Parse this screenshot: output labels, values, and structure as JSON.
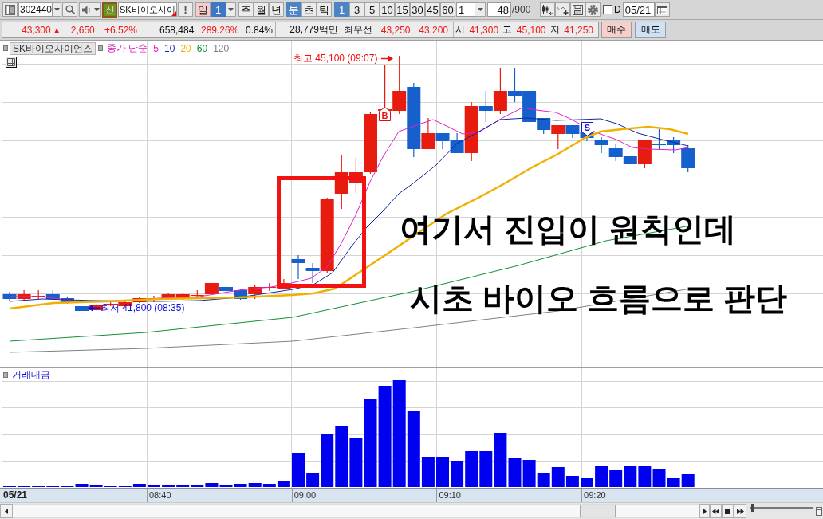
{
  "toolbar": {
    "code_field": {
      "value": "302440"
    },
    "type_badge": "신",
    "name_field": {
      "value": "SK바이오사이"
    },
    "alert_button": "!",
    "day_button": "일",
    "day_count_field": {
      "value": "1"
    },
    "period_buttons": [
      {
        "label": "주",
        "selected": false
      },
      {
        "label": "월",
        "selected": false
      },
      {
        "label": "년",
        "selected": false
      }
    ],
    "unit_buttons": [
      {
        "label": "분",
        "selected": true
      },
      {
        "label": "초",
        "selected": false
      },
      {
        "label": "틱",
        "selected": false
      }
    ],
    "interval_buttons": [
      {
        "label": "1",
        "selected": true
      },
      {
        "label": "3",
        "selected": false
      },
      {
        "label": "5",
        "selected": false
      },
      {
        "label": "10",
        "selected": false
      },
      {
        "label": "15",
        "selected": false
      },
      {
        "label": "30",
        "selected": false
      },
      {
        "label": "45",
        "selected": false
      },
      {
        "label": "60",
        "selected": false
      }
    ],
    "interval_field": {
      "value": "1"
    },
    "count_field": {
      "value": "48"
    },
    "count_total": "/900",
    "checkbox": {
      "label": "D",
      "checked": false
    },
    "date_field": {
      "value": "05/21"
    }
  },
  "quote_bar": {
    "groups": [
      {
        "items": [
          {
            "kind": "up",
            "text": "43,300",
            "sign": "▲"
          },
          {
            "kind": "up",
            "text": "2,650"
          },
          {
            "kind": "up",
            "text": "+6.52%"
          }
        ]
      },
      {
        "items": [
          {
            "kind": "flat",
            "text": "658,484"
          },
          {
            "kind": "up",
            "text": "289.26%"
          },
          {
            "kind": "flat",
            "text": "0.84%"
          }
        ]
      },
      {
        "items": [
          {
            "kind": "flat",
            "text": "28,779백만"
          }
        ]
      },
      {
        "items": [
          {
            "kind": "label",
            "text": "최우선"
          },
          {
            "kind": "up",
            "text": "43,250"
          },
          {
            "kind": "up",
            "text": "43,200"
          }
        ]
      },
      {
        "items": [
          {
            "kind": "label",
            "text": "시"
          },
          {
            "kind": "up",
            "text": "41,300"
          },
          {
            "kind": "label",
            "text": "고"
          },
          {
            "kind": "up",
            "text": "45,100"
          },
          {
            "kind": "label",
            "text": "저"
          },
          {
            "kind": "up",
            "text": "41,250"
          }
        ]
      }
    ],
    "buy_button": "매수",
    "sell_button": "매도"
  },
  "chart": {
    "series_name": "SK바이오사이언스",
    "ma_type": "종가 단순",
    "ma_legend": [
      {
        "label": "5",
        "color": "#e020c8"
      },
      {
        "label": "10",
        "color": "#1428a0"
      },
      {
        "label": "20",
        "color": "#f0b000"
      },
      {
        "label": "60",
        "color": "#109030"
      },
      {
        "label": "120",
        "color": "#808080"
      }
    ],
    "extremes": [
      {
        "kind": "high",
        "text": "최고 45,100 (09:07)"
      },
      {
        "kind": "low",
        "text": "최저 41,800 (08:35)"
      }
    ],
    "signals": [
      {
        "kind": "buy",
        "label": "B"
      },
      {
        "kind": "sell",
        "label": "S"
      }
    ],
    "annotations": [
      "여기서 진입이 원칙인데",
      "시초 바이오 흐름으로 판단"
    ]
  },
  "volume_panel": {
    "title": "거래대금"
  },
  "x_axis": {
    "date": "05/21",
    "ticks": [
      "08:40",
      "09:00",
      "09:10",
      "09:20"
    ]
  },
  "scroll_bar": {
    "zoom_slider": {
      "level": 0.02
    }
  }
}
